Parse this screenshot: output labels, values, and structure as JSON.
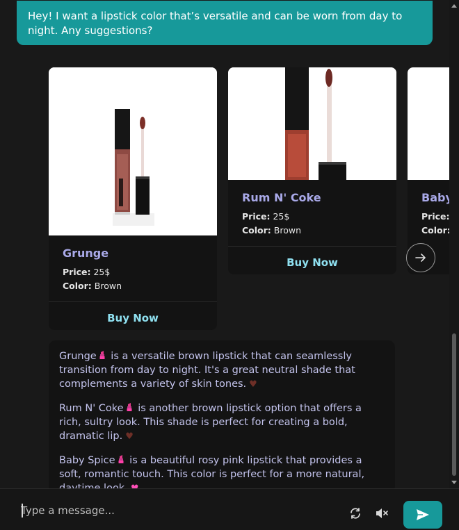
{
  "user_message": "Hey! I want a lipstick color that’s versatile and can be worn from day to night. Any suggestions?",
  "products": [
    {
      "name": "Grunge",
      "price_label": "Price:",
      "price": "25$",
      "color_label": "Color:",
      "color": "Brown",
      "buy_label": "Buy Now"
    },
    {
      "name": "Rum N' Coke",
      "price_label": "Price:",
      "price": "25$",
      "color_label": "Color:",
      "color": "Brown",
      "buy_label": "Buy Now"
    },
    {
      "name": "Baby",
      "price_label": "Price:",
      "price": "",
      "color_label": "Color:",
      "color": "",
      "buy_label": ""
    }
  ],
  "assistant_paragraphs": [
    {
      "name": "Grunge",
      "text": " is a versatile brown lipstick that can seamlessly transition from day to night. It's a great neutral shade that complements a variety of skin tones."
    },
    {
      "name": "Rum N' Coke",
      "text": " is another brown lipstick option that offers a rich, sultry look. This shade is perfect for creating a bold, dramatic lip."
    },
    {
      "name": "Baby Spice",
      "text": " is a beautiful rosy pink lipstick that provides a soft, romantic touch. This color is perfect for a more natural, daytime look."
    }
  ],
  "input": {
    "placeholder": "Type a message..."
  },
  "colors": {
    "accent": "#17999a",
    "title": "#a9a9e8",
    "buy": "#8fe0f0",
    "text": "#c3c3ec"
  },
  "icons": {
    "next": "arrow-right-icon",
    "refresh": "refresh-icon",
    "mute": "mute-icon",
    "send": "send-icon"
  }
}
